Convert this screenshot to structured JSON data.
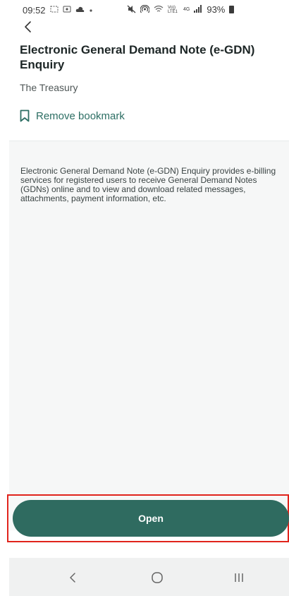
{
  "status_bar": {
    "time": "09:52",
    "left_icons": [
      "screenshot-icon",
      "screen-record-icon",
      "cloud-icon",
      "dot-icon"
    ],
    "right_icons": [
      "mute-icon",
      "hotspot-icon",
      "wifi-icon",
      "volte-icon",
      "4g-icon",
      "signal-icon"
    ],
    "volte_label": "Vo)) LTE1",
    "network_label": "4G",
    "battery_percent": "93%"
  },
  "header": {
    "title": "Electronic General Demand Note (e-GDN) Enquiry",
    "provider": "The Treasury",
    "bookmark_label": "Remove bookmark"
  },
  "description": "Electronic General Demand Note (e-GDN) Enquiry provides e-billing services for registered users to receive General Demand Notes (GDNs) online and to view and download related messages, attachments, payment information, etc.",
  "actions": {
    "open_label": "Open"
  },
  "colors": {
    "accent": "#2f6b60",
    "highlight_box": "#e0241c",
    "panel_bg": "#f6f7f7"
  }
}
